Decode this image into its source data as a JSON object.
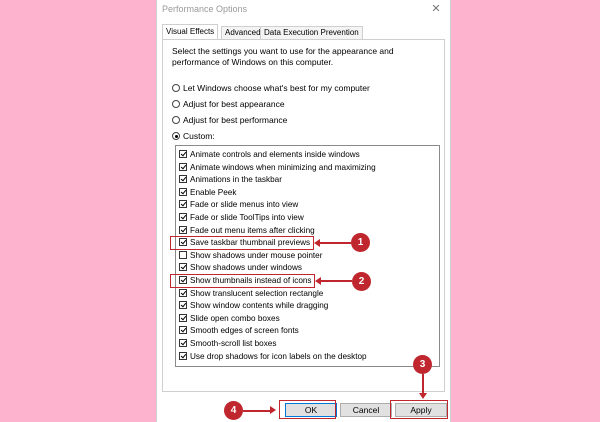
{
  "window": {
    "title": "Performance Options",
    "close_glyph": "✕"
  },
  "tabs": [
    {
      "label": "Visual Effects",
      "active": true
    },
    {
      "label": "Advanced",
      "active": false
    },
    {
      "label": "Data Execution Prevention",
      "active": false
    }
  ],
  "intro_text": "Select the settings you want to use for the appearance and performance of Windows on this computer.",
  "radios": [
    {
      "label": "Let Windows choose what's best for my computer",
      "selected": false
    },
    {
      "label": "Adjust for best appearance",
      "selected": false
    },
    {
      "label": "Adjust for best performance",
      "selected": false
    },
    {
      "label": "Custom:",
      "selected": true
    }
  ],
  "effects": [
    {
      "label": "Animate controls and elements inside windows",
      "checked": true
    },
    {
      "label": "Animate windows when minimizing and maximizing",
      "checked": true
    },
    {
      "label": "Animations in the taskbar",
      "checked": true
    },
    {
      "label": "Enable Peek",
      "checked": true
    },
    {
      "label": "Fade or slide menus into view",
      "checked": true
    },
    {
      "label": "Fade or slide ToolTips into view",
      "checked": true
    },
    {
      "label": "Fade out menu items after clicking",
      "checked": true
    },
    {
      "label": "Save taskbar thumbnail previews",
      "checked": true
    },
    {
      "label": "Show shadows under mouse pointer",
      "checked": false
    },
    {
      "label": "Show shadows under windows",
      "checked": true
    },
    {
      "label": "Show thumbnails instead of icons",
      "checked": true
    },
    {
      "label": "Show translucent selection rectangle",
      "checked": true
    },
    {
      "label": "Show window contents while dragging",
      "checked": true
    },
    {
      "label": "Slide open combo boxes",
      "checked": true
    },
    {
      "label": "Smooth edges of screen fonts",
      "checked": true
    },
    {
      "label": "Smooth-scroll list boxes",
      "checked": true
    },
    {
      "label": "Use drop shadows for icon labels on the desktop",
      "checked": true
    }
  ],
  "buttons": {
    "ok": "OK",
    "cancel": "Cancel",
    "apply": "Apply"
  },
  "annotations": {
    "step1": "1",
    "step2": "2",
    "step3": "3",
    "step4": "4"
  },
  "colors": {
    "background": "#fdb2cd",
    "annotation_red": "#c0262d",
    "focus_blue": "#0078d7"
  }
}
